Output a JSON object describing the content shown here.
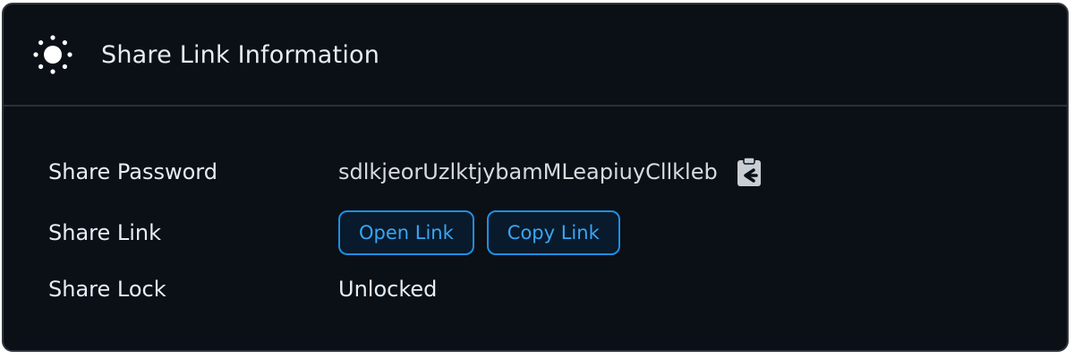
{
  "header": {
    "title": "Share Link Information",
    "icon": "sun-icon"
  },
  "rows": {
    "password": {
      "label": "Share Password",
      "value": "sdlkjeorUzlktjybamMLeapiuyCllkleb",
      "copy_icon": "clipboard-copy-icon"
    },
    "link": {
      "label": "Share Link",
      "open_label": "Open Link",
      "copy_label": "Copy Link"
    },
    "lock": {
      "label": "Share Lock",
      "value": "Unlocked"
    }
  },
  "colors": {
    "background": "#0b0f16",
    "border": "#30363d",
    "text": "#e6edf3",
    "accent": "#1f8fe0"
  }
}
